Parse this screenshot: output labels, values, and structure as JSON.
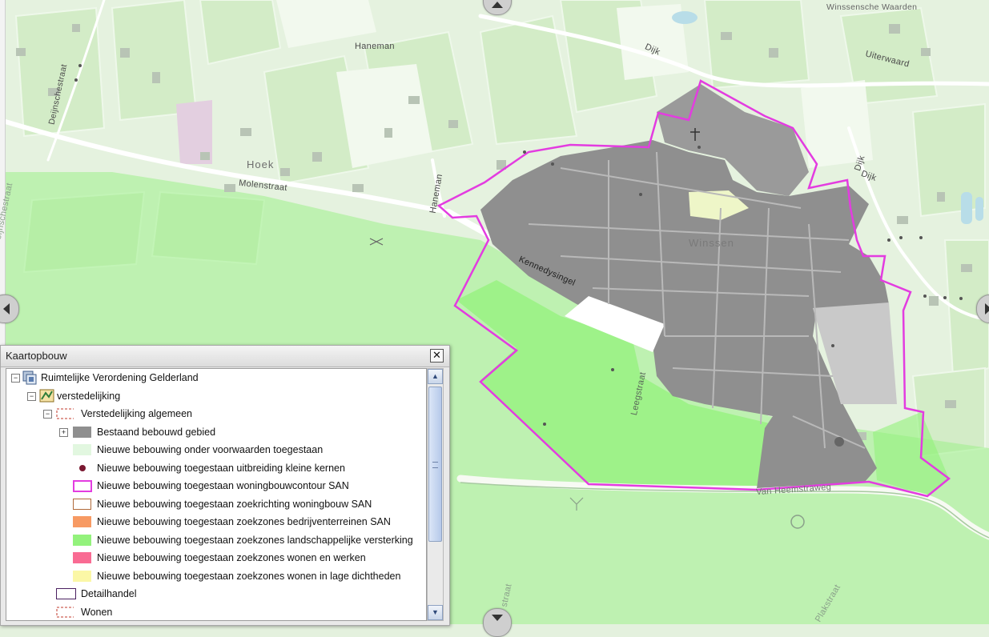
{
  "map": {
    "labels": {
      "winssensche_waarden": "Winssensche Waarden",
      "haneman_top": "Haneman",
      "dijk_top": "Dijk",
      "uiterwaard": "Uiterwaard",
      "deijnschestraat_top": "Deijnschestraat",
      "hoek": "Hoek",
      "molenstraat": "Molenstraat",
      "haneman_mid": "Haneman",
      "dijk_right_1": "Dijk",
      "dijk_right_2": "Dijk",
      "deijnschestraat_left": "Deijnschestraat",
      "winssen": "Winssen",
      "kennedysingel": "Kennedysingel",
      "leegstraat": "Leegstraat",
      "van_heemstraweg": "Van Heemstraweg",
      "bottom_straat": "straat",
      "plakstraat": "Plakstraat"
    },
    "colors": {
      "background": "#e4f1de",
      "built_area": "#8f8f8f",
      "landscape_zone": "#93f27c",
      "contour": "#e33ce0"
    }
  },
  "legend": {
    "title": "Kaartopbouw",
    "close_label": "✕",
    "items": [
      {
        "label": "Ruimtelijke Verordening Gelderland",
        "toggle": "−",
        "symbol": "service-icon"
      },
      {
        "label": "verstedelijking",
        "toggle": "−",
        "symbol": "layer-icon"
      },
      {
        "label": "Verstedelijking algemeen",
        "toggle": "−",
        "symbol": "dashed-red"
      },
      {
        "label": "Bestaand bebouwd gebied",
        "toggle": "+",
        "symbol": "fill",
        "color": "#8f8f8f"
      },
      {
        "label": "Nieuwe bebouwing onder voorwaarden toegestaan",
        "symbol": "fill",
        "color": "#e2f7e0"
      },
      {
        "label": "Nieuwe bebouwing toegestaan uitbreiding kleine kernen",
        "symbol": "dot",
        "color": "#7a1830"
      },
      {
        "label": "Nieuwe bebouwing toegestaan woningbouwcontour SAN",
        "symbol": "outline",
        "color": "#e33ce0"
      },
      {
        "label": "Nieuwe bebouwing toegestaan zoekrichting woningbouw SAN",
        "symbol": "outline",
        "color": "#b06a3a"
      },
      {
        "label": "Nieuwe bebouwing toegestaan zoekzones bedrijventerreinen SAN",
        "symbol": "fill",
        "color": "#f79a63"
      },
      {
        "label": "Nieuwe bebouwing toegestaan zoekzones landschappelijke versterking",
        "symbol": "fill",
        "color": "#93f27c"
      },
      {
        "label": "Nieuwe bebouwing toegestaan zoekzones wonen en werken",
        "symbol": "fill",
        "color": "#f96b93"
      },
      {
        "label": "Nieuwe bebouwing toegestaan zoekzones wonen in lage dichtheden",
        "symbol": "fill",
        "color": "#fbf7a6"
      },
      {
        "label": "Detailhandel",
        "symbol": "outline",
        "color": "#4a2060"
      },
      {
        "label": "Wonen",
        "symbol": "dashed-red"
      }
    ]
  }
}
